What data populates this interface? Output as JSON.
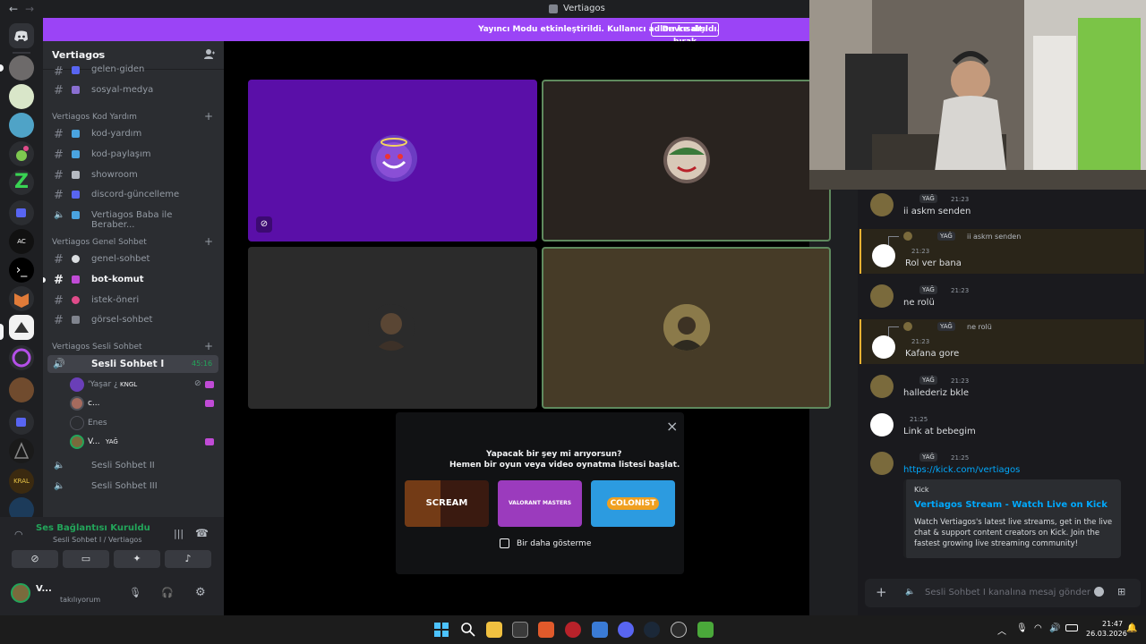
{
  "window": {
    "title": "Vertiagos",
    "nav_back": "←",
    "nav_forward": "→"
  },
  "banner": {
    "message": "Yayıncı Modu etkinleştirildi. Kullanıcı adları kısaltıldı.",
    "button": "Devre dışı bırak"
  },
  "guild": {
    "name": "Vertiagos",
    "chevron": "⌄"
  },
  "channels_top": [
    {
      "label": "gelen-giden"
    },
    {
      "label": "sosyal-medya"
    }
  ],
  "categories": {
    "kod": "Vertiagos Kod Yardım",
    "genel": "Vertiagos Genel Sohbet",
    "sesli": "Vertiagos Sesli Sohbet"
  },
  "kod_channels": [
    {
      "label": "kod-yardım"
    },
    {
      "label": "kod-paylaşım"
    },
    {
      "label": "showroom"
    },
    {
      "label": "discord-güncelleme"
    },
    {
      "label": "Vertiagos Baba ile Beraber..."
    }
  ],
  "genel_channels": [
    {
      "label": "genel-sohbet"
    },
    {
      "label": "bot-komut"
    },
    {
      "label": "istek-öneri"
    },
    {
      "label": "görsel-sohbet"
    }
  ],
  "voice_channels": {
    "active": "Sesli Sohbet I",
    "active_time": "45:16",
    "second": "Sesli Sohbet II",
    "third": "Sesli Sohbet III"
  },
  "voice_users": [
    {
      "name": "'Yaşar ¿",
      "tag": "KNGL"
    },
    {
      "name": "c...",
      "tag": ""
    },
    {
      "name": "Enes",
      "tag": ""
    },
    {
      "name": "V...",
      "tag": "YAĞ"
    }
  ],
  "voice_panel": {
    "status": "Ses Bağlantısı Kuruldu",
    "location": "Sesli Sohbet I / Vertiagos"
  },
  "user_panel": {
    "name": "V...",
    "status": "takılıyorum"
  },
  "overlay": {
    "line1": "Yapacak bir şey mi arıyorsun?",
    "line2": "Hemen bir oyun veya video oynatma listesi başlat.",
    "games": [
      "SCREAM",
      "VALORANT MASTERS",
      "COLONIST"
    ],
    "checkbox_label": "Bir daha gösterme",
    "close": "×"
  },
  "chat": {
    "messages": [
      {
        "role": "YAĞ",
        "time": "21:23",
        "text": "ii askm senden"
      },
      {
        "reply_role": "YAĞ",
        "reply_text": "ii askm senden",
        "time": "21:23",
        "text": "Rol ver bana"
      },
      {
        "role": "YAĞ",
        "time": "21:23",
        "text": "ne rolü"
      },
      {
        "reply_role": "YAĞ",
        "reply_text": "ne rolü",
        "time": "21:23",
        "text": "Kafana gore"
      },
      {
        "role": "YAĞ",
        "time": "21:23",
        "text": "hallederiz bkle"
      },
      {
        "time": "21:25",
        "text": "Link at bebegim"
      },
      {
        "role": "YAĞ",
        "time": "21:25",
        "text": "https://kick.com/vertiagos"
      }
    ],
    "embed": {
      "provider": "Kick",
      "title": "Vertiagos Stream - Watch Live on Kick",
      "description": "Watch Vertiagos's latest live streams, get in the live chat & support content creators on Kick. Join the fastest growing live streaming community!"
    },
    "composer_placeholder": "Sesli Sohbet I kanalına mesaj gönder"
  },
  "taskbar": {
    "time": "21:47",
    "date": "26.03.2026"
  },
  "colors": {
    "accent": "#9b44f6",
    "speaking": "#23a55a",
    "link": "#00a8fc"
  }
}
